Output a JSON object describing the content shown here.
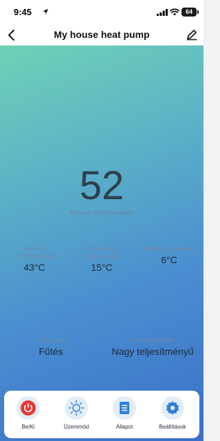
{
  "status_bar": {
    "time": "9:45",
    "battery": "64"
  },
  "header": {
    "title": "My house heat pump"
  },
  "main": {
    "outlet_temp": {
      "value": "52",
      "label": "Kimenő vízhőmérséklet"
    },
    "stats": [
      {
        "label_lines": [
          "Bemenő",
          "vízhőmérséklet"
        ],
        "value": "43°C"
      },
      {
        "label_lines": [
          "A víztartály",
          "hőmérséklete"
        ],
        "value": "15°C"
      },
      {
        "label_lines": [
          "Külső hőmérséklet"
        ],
        "value": "6°C"
      }
    ],
    "mode": {
      "label": "Üzemmód",
      "value": "Fűtés"
    },
    "frequency": {
      "label": "Frekvenciamód",
      "value": "Nagy teljesítményű"
    }
  },
  "actions": [
    {
      "label": "Be/Ki",
      "icon": "power-icon"
    },
    {
      "label": "Üzemmód",
      "icon": "sun-icon"
    },
    {
      "label": "Állapot",
      "icon": "status-list-icon"
    },
    {
      "label": "Beállítások",
      "icon": "gear-icon"
    }
  ],
  "colors": {
    "power_red": "#e53935",
    "accent_blue": "#2f7fd8",
    "action_circle_bg": "#e2edf8",
    "gradient_top": "#6fd2b6",
    "gradient_bottom": "#3b70c8"
  }
}
